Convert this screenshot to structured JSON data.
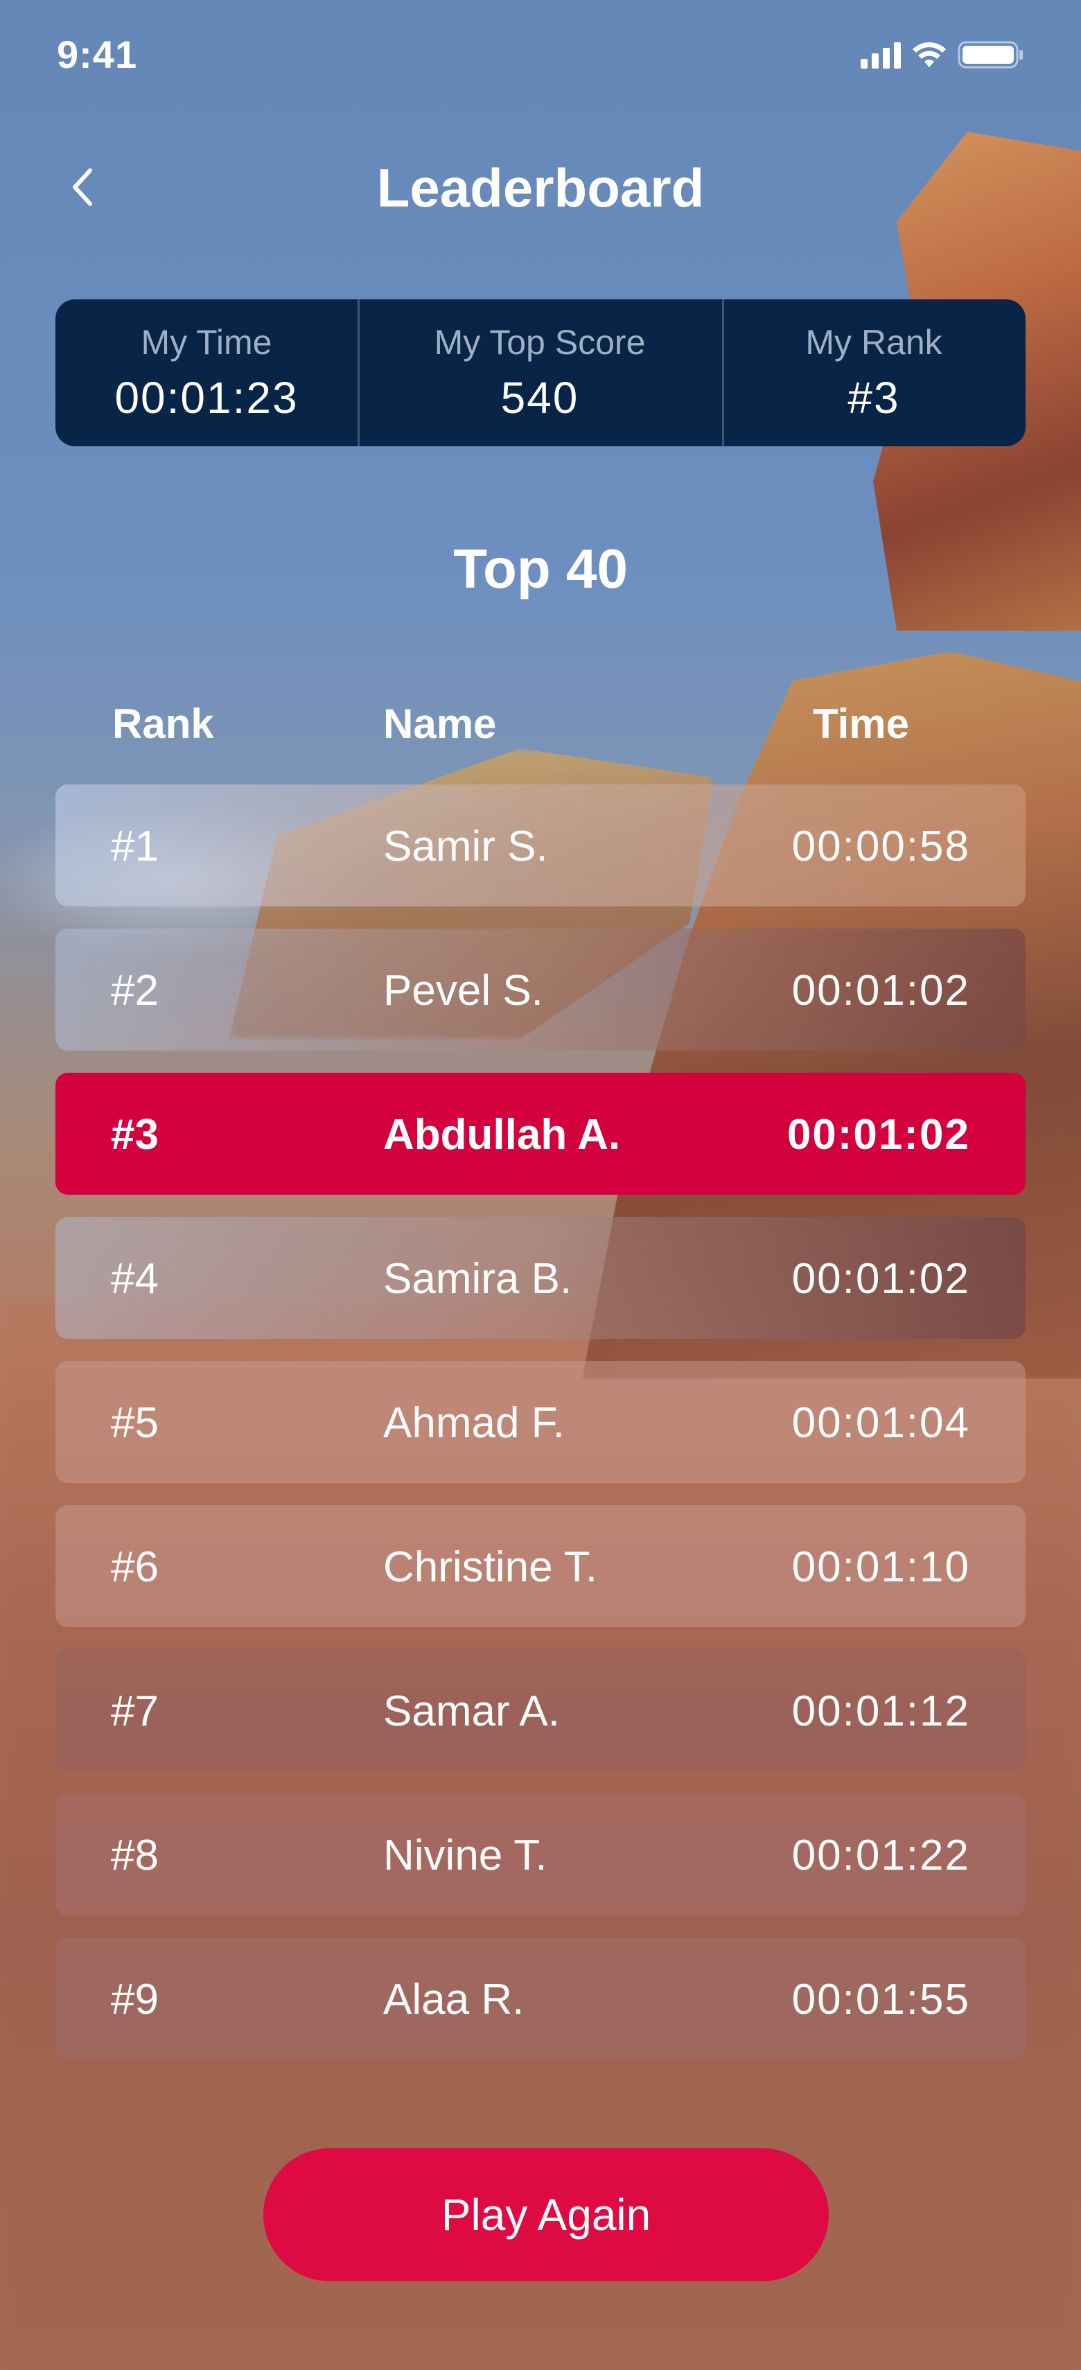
{
  "status_bar": {
    "time": "9:41",
    "icons": [
      "signal-icon",
      "wifi-icon",
      "battery-icon"
    ]
  },
  "header": {
    "title": "Leaderboard",
    "back_icon": "chevron-left-icon"
  },
  "stats": [
    {
      "label": "My Time",
      "value": "00:01:23"
    },
    {
      "label": "My Top Score",
      "value": "540"
    },
    {
      "label": "My Rank",
      "value": "#3"
    }
  ],
  "section_title": "Top 40",
  "table": {
    "headers": {
      "rank": "Rank",
      "name": "Name",
      "time": "Time"
    },
    "rows": [
      {
        "rank": "#1",
        "name": "Samir S.",
        "time": "00:00:58"
      },
      {
        "rank": "#2",
        "name": "Pevel S.",
        "time": "00:01:02"
      },
      {
        "rank": "#3",
        "name": "Abdullah A.",
        "time": "00:01:02",
        "current_user": true
      },
      {
        "rank": "#4",
        "name": "Samira B.",
        "time": "00:01:02"
      },
      {
        "rank": "#5",
        "name": "Ahmad F.",
        "time": "00:01:04"
      },
      {
        "rank": "#6",
        "name": "Christine T.",
        "time": "00:01:10"
      },
      {
        "rank": "#7",
        "name": "Samar A.",
        "time": "00:01:12"
      },
      {
        "rank": "#8",
        "name": "Nivine T.",
        "time": "00:01:22"
      },
      {
        "rank": "#9",
        "name": "Alaa R.",
        "time": "00:01:55"
      }
    ]
  },
  "play_again_label": "Play Again",
  "colors": {
    "accent": "#d4003e",
    "stats_panel": "#082446",
    "sky": "#6487b8"
  }
}
